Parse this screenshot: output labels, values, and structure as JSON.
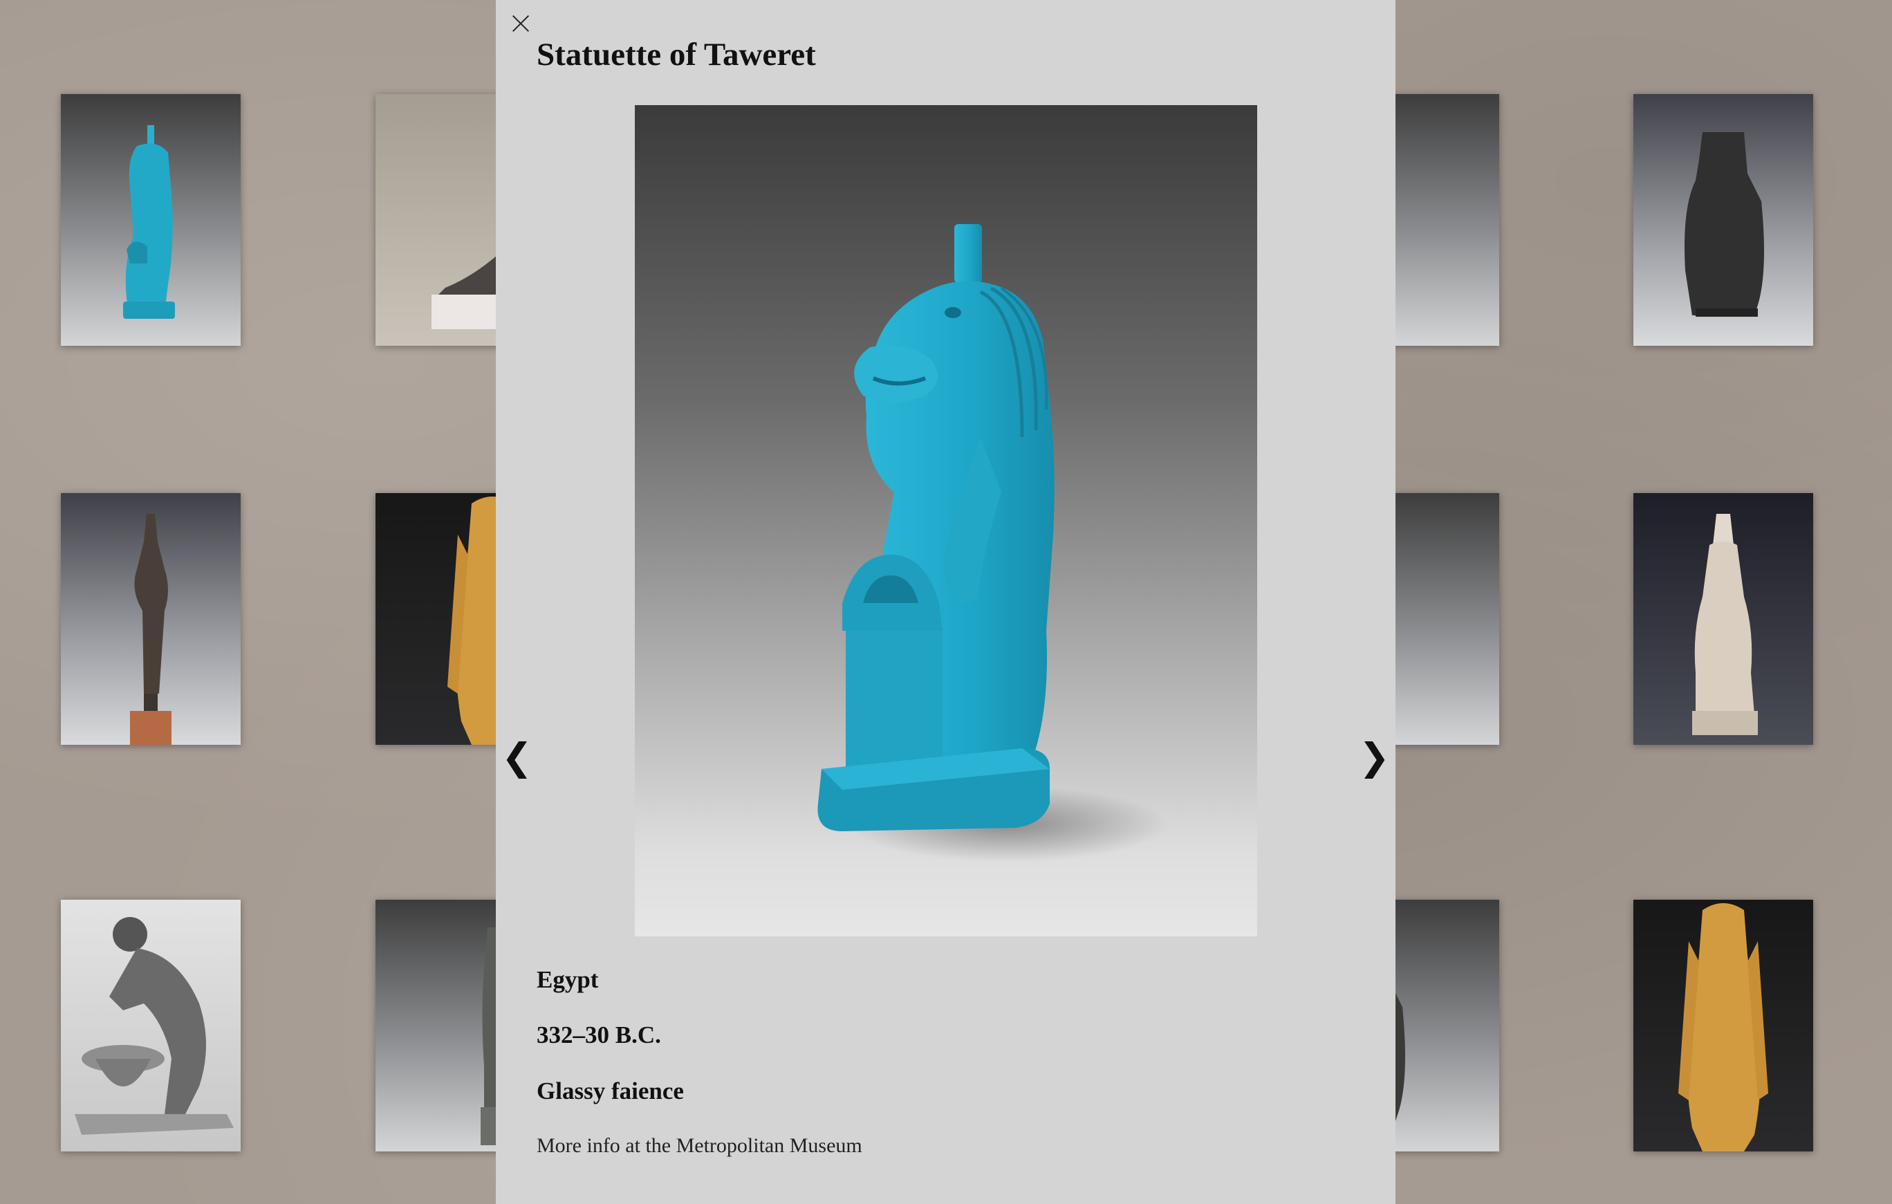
{
  "modal": {
    "title": "Statuette of Taweret",
    "image_alt": "Turquoise faience statuette of the hippopotamus goddess Taweret",
    "prev_label": "❮",
    "next_label": "❯",
    "close_label": "×",
    "culture": "Egypt",
    "date": "332–30 B.C.",
    "medium": "Glassy faience",
    "more_info_link": "More info at the Metropolitan Museum"
  },
  "colors": {
    "modal_bg": "#d4d4d4",
    "page_bg": "#a69b92",
    "faience_blue": "#2fb2d2"
  }
}
